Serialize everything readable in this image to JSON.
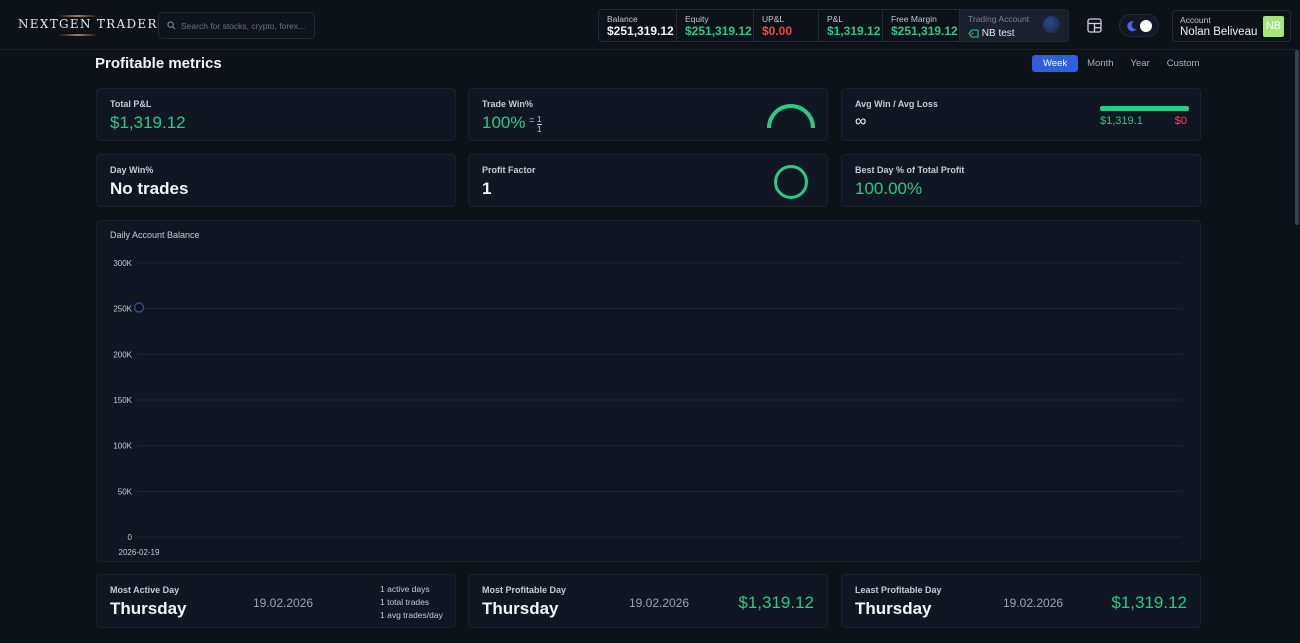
{
  "brand": {
    "logo_text": "NEXTGEN TRADER"
  },
  "search": {
    "placeholder": "Search for stocks, crypto, forex..."
  },
  "stats": {
    "balance_label": "Balance",
    "balance_value": "$251,319.12",
    "equity_label": "Equity",
    "equity_value": "$251,319.12",
    "upl_label": "UP&L",
    "upl_value": "$0.00",
    "pl_label": "P&L",
    "pl_value": "$1,319.12",
    "free_margin_label": "Free Margin",
    "free_margin_value": "$251,319.12",
    "trading_account_label": "Trading Account",
    "trading_account_value": "NB test"
  },
  "account": {
    "label": "Account",
    "name": "Nolan Beliveau",
    "initials": "NB"
  },
  "page": {
    "title": "Profitable metrics"
  },
  "tabs": [
    "Week",
    "Month",
    "Year",
    "Custom"
  ],
  "cards": {
    "total_pl": {
      "title": "Total P&L",
      "value": "$1,319.12"
    },
    "trade_win": {
      "title": "Trade Win%",
      "value": "100%",
      "eq": "=",
      "num": "1",
      "den": "1"
    },
    "avg_win_loss": {
      "title": "Avg Win / Avg Loss",
      "value": "∞",
      "win": "$1,319.1",
      "loss": "$0",
      "win_fraction": 1.0
    },
    "day_win": {
      "title": "Day Win%",
      "value": "No trades"
    },
    "profit_factor": {
      "title": "Profit Factor",
      "value": "1"
    },
    "best_day": {
      "title": "Best Day % of Total Profit",
      "value": "100.00%"
    }
  },
  "chart_data": {
    "type": "line",
    "title": "Daily Account Balance",
    "x": [
      "2026-02-19"
    ],
    "series": [
      {
        "values": [
          251319.12
        ]
      }
    ],
    "ylim": [
      0,
      300000
    ],
    "yticks": [
      "0",
      "50K",
      "100K",
      "150K",
      "200K",
      "250K",
      "300K"
    ],
    "xticks": [
      "2026-02-19"
    ],
    "grid": true
  },
  "bottom": {
    "most_active": {
      "title": "Most Active Day",
      "day": "Thursday",
      "date": "19.02.2026",
      "info": [
        "1 active days",
        "1 total trades",
        "1 avg trades/day"
      ]
    },
    "most_profitable": {
      "title": "Most Profitable Day",
      "day": "Thursday",
      "date": "19.02.2026",
      "amount": "$1,319.12"
    },
    "least_profitable": {
      "title": "Least Profitable Day",
      "day": "Thursday",
      "date": "19.02.2026",
      "amount": "$1,319.12"
    }
  },
  "colors": {
    "accent": "#2f5fdc",
    "positive": "#2bc986",
    "negative": "#ef4a4a",
    "avatar": "#a6e37a"
  }
}
